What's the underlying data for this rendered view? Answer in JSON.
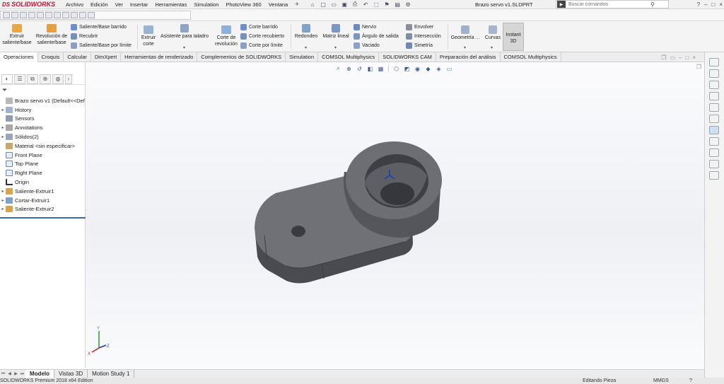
{
  "app": {
    "brand": "SOLIDWORKS",
    "brand_prefix": "DS",
    "menu": [
      "Archivo",
      "Edición",
      "Ver",
      "Insertar",
      "Herramientas",
      "Simulation",
      "PhotoView 360",
      "Ventana"
    ],
    "doc_title": "Brazo servo v1.SLDPRT",
    "search_placeholder": "Buscar comandos"
  },
  "ribbon": {
    "extruir_saliente": "Extruir saliente/base",
    "revolucion_saliente": "Revolución de saliente/base",
    "saliente_barrido": "Saliente/Base barrido",
    "recubrir": "Recubrir",
    "saliente_limite": "Saliente/Base por límite",
    "extruir_corte": "Extruir corte",
    "asistente_taladro": "Asistente para taladro",
    "corte_revolucion": "Corte de revolución",
    "corte_barrido": "Corte barrido",
    "corte_recubierto": "Corte recubierto",
    "corte_limite": "Corte por límite",
    "redondeo": "Redondeo",
    "matriz_lineal": "Matriz lineal",
    "nervio": "Nervio",
    "angulo_salida": "Ángulo de salida",
    "vaciado": "Vaciado",
    "envolver": "Envolver",
    "interseccion": "Intersección",
    "simetria": "Simetría",
    "geometria_ref": "Geometría ...",
    "curvas": "Curvas",
    "instant3d": "Instant 3D"
  },
  "tabs": [
    "Operaciones",
    "Croquis",
    "Calcular",
    "DimXpert",
    "Herramientas de renderizado",
    "Complementos de SOLIDWORKS",
    "Simulation",
    "COMSOL Multiphysics",
    "SOLIDWORKS CAM",
    "Preparación del análisis",
    "COMSOL Multiphysics"
  ],
  "feature_tree": [
    {
      "label": "Brazo servo v1  (Default<<Def",
      "icon": "part",
      "expand": ""
    },
    {
      "label": "History",
      "icon": "history",
      "expand": "▸"
    },
    {
      "label": "Sensors",
      "icon": "sensor",
      "expand": ""
    },
    {
      "label": "Annotations",
      "icon": "annotation",
      "expand": "▸"
    },
    {
      "label": "Sólidos(2)",
      "icon": "solid-bodies",
      "expand": "▸"
    },
    {
      "label": "Material <sin especificar>",
      "icon": "material",
      "expand": ""
    },
    {
      "label": "Front Plane",
      "icon": "plane",
      "expand": ""
    },
    {
      "label": "Top Plane",
      "icon": "plane",
      "expand": ""
    },
    {
      "label": "Right Plane",
      "icon": "plane",
      "expand": ""
    },
    {
      "label": "Origin",
      "icon": "origin",
      "expand": ""
    },
    {
      "label": "Saliente-Extruir1",
      "icon": "extrude",
      "expand": "▸"
    },
    {
      "label": "Cortar-Extruir1",
      "icon": "cut",
      "expand": "▸"
    },
    {
      "label": "Saliente-Extruir2",
      "icon": "extrude",
      "expand": "▸"
    }
  ],
  "bottom_tabs": [
    "Modelo",
    "Vistas 3D",
    "Motion Study 1"
  ],
  "status": {
    "edition": "SOLIDWORKS Premium 2018 x64 Edition",
    "mode": "Editando Pieza",
    "units": "MMGS"
  },
  "colors": {
    "brand_red": "#c8102e",
    "part_top": "#6f7075",
    "part_side": "#55565b",
    "part_dark": "#3d3e43"
  }
}
